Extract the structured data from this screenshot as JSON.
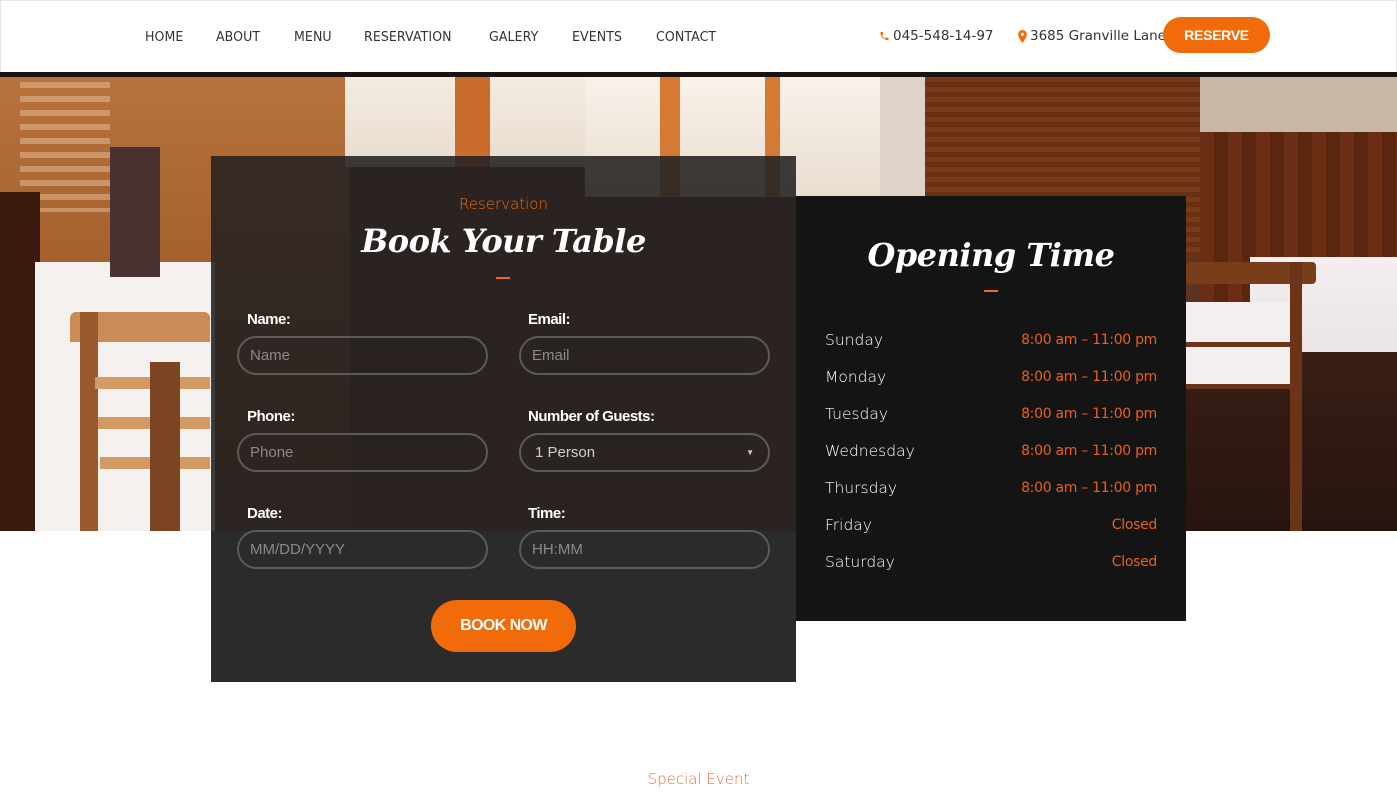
{
  "header": {
    "nav": [
      {
        "label": "HOME"
      },
      {
        "label": "ABOUT"
      },
      {
        "label": "MENU"
      },
      {
        "label": "RESERVATION"
      },
      {
        "label": "GALERY"
      },
      {
        "label": "EVENTS"
      },
      {
        "label": "CONTACT"
      }
    ],
    "phone": "045-548-14-97",
    "phone_icon": "phone-icon",
    "address": "3685 Granville Lane",
    "address_icon": "map-marker-icon",
    "reserve_label": "RESERVE"
  },
  "booking": {
    "eyebrow": "Reservation",
    "title": "Book Your Table",
    "fields": {
      "name": {
        "label": "Name:",
        "placeholder": "Name",
        "value": ""
      },
      "email": {
        "label": "Email:",
        "placeholder": "Email",
        "value": ""
      },
      "phone": {
        "label": "Phone:",
        "placeholder": "Phone",
        "value": ""
      },
      "guests": {
        "label": "Number of Guests:",
        "selected": "1 Person"
      },
      "date": {
        "label": "Date:",
        "placeholder": "MM/DD/YYYY",
        "value": ""
      },
      "time": {
        "label": "Time:",
        "placeholder": "HH:MM",
        "value": ""
      }
    },
    "submit_label": "BOOK NOW"
  },
  "opening": {
    "title": "Opening Time",
    "hours": [
      {
        "day": "Sunday",
        "time": "8:00 am – 11:00 pm"
      },
      {
        "day": "Monday",
        "time": "8:00 am – 11:00 pm"
      },
      {
        "day": "Tuesday",
        "time": "8:00 am – 11:00 pm"
      },
      {
        "day": "Wednesday",
        "time": "8:00 am – 11:00 pm"
      },
      {
        "day": "Thursday",
        "time": "8:00 am – 11:00 pm"
      },
      {
        "day": "Friday",
        "time": "Closed"
      },
      {
        "day": "Saturday",
        "time": "Closed"
      }
    ]
  },
  "next_section": {
    "eyebrow": "Special Event"
  },
  "colors": {
    "accent": "#f26b0a",
    "card_dark": "#141414",
    "card_form": "#2b2b2b",
    "text_light": "#ffffff"
  }
}
